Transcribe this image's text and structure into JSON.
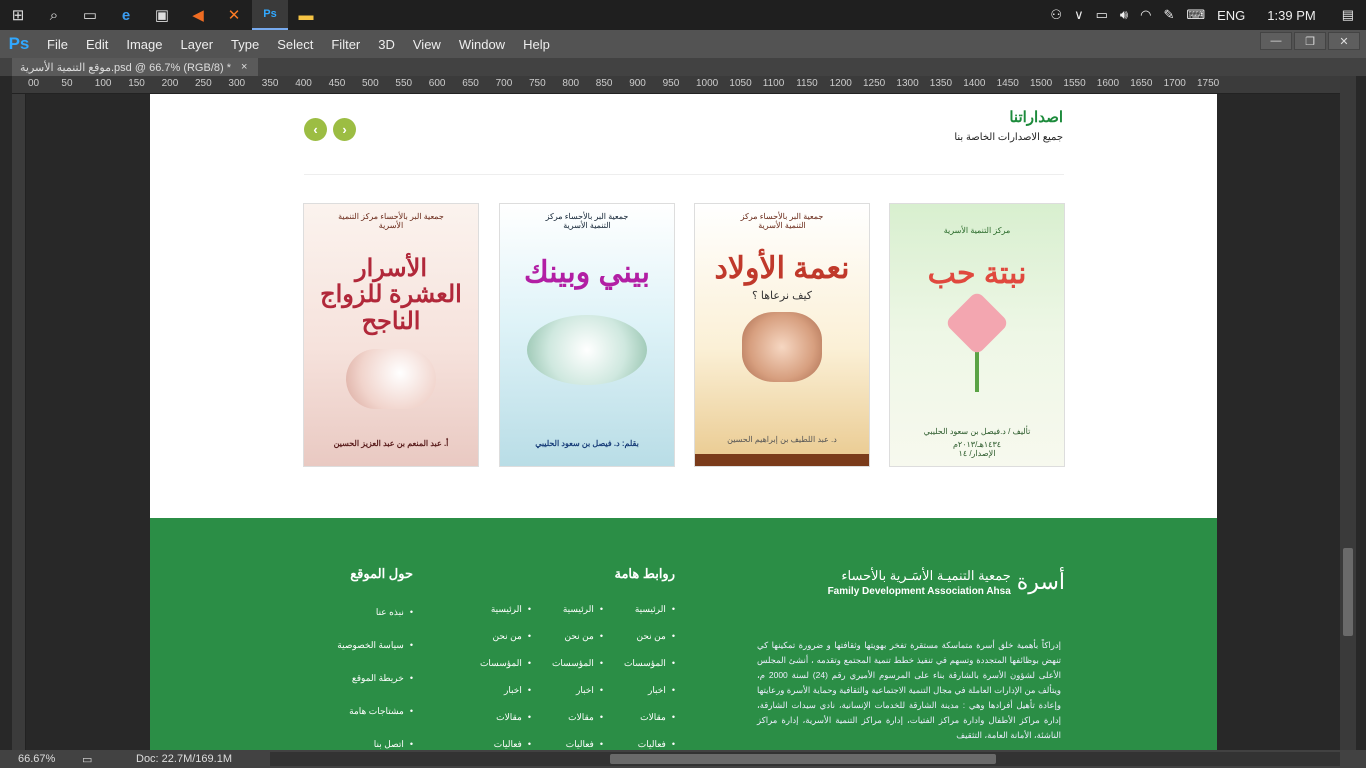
{
  "taskbar": {
    "time": "1:39 PM",
    "language": "ENG"
  },
  "menubar": {
    "logo": "Ps",
    "items": [
      "File",
      "Edit",
      "Image",
      "Layer",
      "Type",
      "Select",
      "Filter",
      "3D",
      "View",
      "Window",
      "Help"
    ]
  },
  "document": {
    "tab_title": "موقع التنمية الأسرية.psd @ 66.7% (RGB/8) *",
    "close": "×"
  },
  "ruler": {
    "marks": [
      "00",
      "50",
      "100",
      "150",
      "200",
      "250",
      "300",
      "350",
      "400",
      "450",
      "500",
      "550",
      "600",
      "650",
      "700",
      "750",
      "800",
      "850",
      "900",
      "950",
      "1000",
      "1050",
      "1100",
      "1150",
      "1200",
      "1250",
      "1300",
      "1350",
      "1400",
      "1450",
      "1500",
      "1550",
      "1600",
      "1650",
      "1700",
      "1750"
    ]
  },
  "status": {
    "zoom": "66.67%",
    "doc_info": "Doc: 22.7M/169.1M"
  },
  "page": {
    "publications": {
      "title": "اصداراتنا",
      "subtitle": "جميع الاصدارات الخاصة بنا",
      "prev": "‹",
      "next": "›",
      "books": [
        {
          "org": "جمعية البر بالأحساء مركز التنمية الأسرية",
          "title": "الأسرار العشرة للزواج الناجح",
          "author": "أ. عبد المنعم بن عبد العزيز الحسين"
        },
        {
          "org": "جمعية البر بالأحساء مركز التنمية الأسرية",
          "title": "بيني وبينك",
          "author": "بقلم: د. فيصل بن سعود الحليبي"
        },
        {
          "org": "جمعية البر بالأحساء مركز التنمية الأسرية",
          "title": "نعمة الأولاد",
          "subtitle": "كيف نرعاها ؟",
          "author": "د. عبد اللطيف بن إبراهيم الحسين"
        },
        {
          "org": "مركز التنمية الأسرية",
          "title": "نبتة حب",
          "author": "تأليف / د.فيصل بن سعود الحليبي",
          "year": "١٤٣٤هـ/٢٠١٣م",
          "edition": "الإصدار/ ١٤"
        }
      ]
    },
    "footer": {
      "logo_ar": "جمعية التنميـة الأسَـرية بالأحساء",
      "logo_en": "Family Development Association Ahsa",
      "logo_mark": "أسرة",
      "about": "إدراكاً بأهمية خلق أسرة متماسكة مستقرة تفخر بهويتها وثقافتها و ضرورة تمكينها كي تنهض بوظائفها المتجددة وتسهم في تنفيذ خطط تنمية المجتمع وتقدمه ، أنشئ المجلس الأعلى لشؤون الأسرة بالشارقة بناء على المرسوم الأميري رقم (24) لسنة 2000 م، ويتألف من الإدارات العاملة في مجال التنمية الاجتماعية والثقافية وحماية الأسرة ورعايتها وإعادة تأهيل أفرادها وهي : مدينة الشارقة للخدمات الإنسانية، نادي سيدات الشارقة، إدارة مراكز الأطفال وادارة مراكز الفتيات، إدارة مراكز التنمية الأسرية، إدارة مراكز الناشئة، الأمانة العامة، التثقيف",
      "links_title": "روابط هامة",
      "links_col1": [
        "الرئيسية",
        "من نحن",
        "المؤسسات",
        "اخبار",
        "مقالات",
        "فعاليات"
      ],
      "links_col2": [
        "الرئيسية",
        "من نحن",
        "المؤسسات",
        "اخبار",
        "مقالات",
        "فعاليات"
      ],
      "links_col3": [
        "الرئيسية",
        "من نحن",
        "المؤسسات",
        "اخبار",
        "مقالات",
        "فعاليات"
      ],
      "about_title": "حول الموقع",
      "about_links": [
        "نبذه عنا",
        "سياسة الخصوصية",
        "خريطة الموقع",
        "مشتاجات هامة",
        "اتصل بنا"
      ]
    }
  }
}
